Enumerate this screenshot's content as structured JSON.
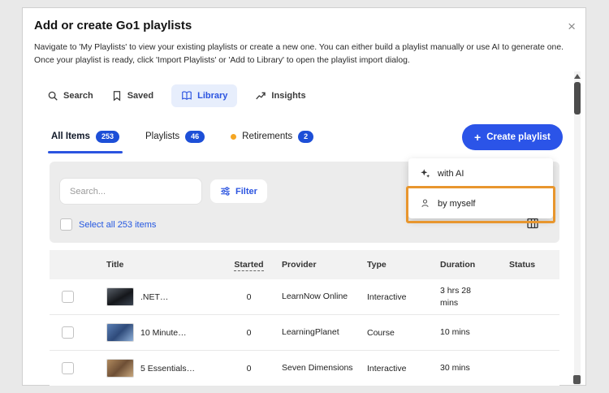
{
  "modal": {
    "title": "Add or create Go1 playlists",
    "close": "×",
    "description": "Navigate to 'My Playlists' to view your existing playlists or create a new one. You can either build a playlist manually or use AI to generate one. Once your playlist is ready, click 'Import Playlists' or 'Add to Library' to open the playlist import dialog."
  },
  "nav": {
    "items": [
      {
        "label": "Search",
        "icon": "search-icon"
      },
      {
        "label": "Saved",
        "icon": "bookmark-icon"
      },
      {
        "label": "Library",
        "icon": "open-book-icon",
        "active": true
      },
      {
        "label": "Insights",
        "icon": "trending-arrow-icon"
      }
    ]
  },
  "tabs": {
    "items": [
      {
        "label": "All Items",
        "badge": "253",
        "active": true
      },
      {
        "label": "Playlists",
        "badge": "46"
      },
      {
        "label": "Retirements",
        "badge": "2",
        "dot": true
      }
    ]
  },
  "create": {
    "label": "Create playlist",
    "plus": "+",
    "menu": {
      "ai": "with AI",
      "myself": "by myself"
    }
  },
  "toolbar": {
    "search_placeholder": "Search...",
    "filter": "Filter",
    "select_all": "Select all 253 items"
  },
  "table": {
    "headers": {
      "title": "Title",
      "started": "Started",
      "provider": "Provider",
      "type": "Type",
      "duration": "Duration",
      "status": "Status"
    },
    "rows": [
      {
        "title": ".NET…",
        "started": "0",
        "provider": "LearnNow Online",
        "type": "Interactive",
        "duration": "3 hrs 28 mins",
        "status": ""
      },
      {
        "title": "10 Minute…",
        "started": "0",
        "provider": "LearningPlanet",
        "type": "Course",
        "duration": "10 mins",
        "status": ""
      },
      {
        "title": "5 Essentials…",
        "started": "0",
        "provider": "Seven Dimensions",
        "type": "Interactive",
        "duration": "30 mins",
        "status": ""
      }
    ]
  },
  "colors": {
    "accent": "#2b54e8",
    "badge": "#1d4fd7",
    "annotation_highlight": "#e8962e",
    "retirement_dot": "#f5a623"
  }
}
